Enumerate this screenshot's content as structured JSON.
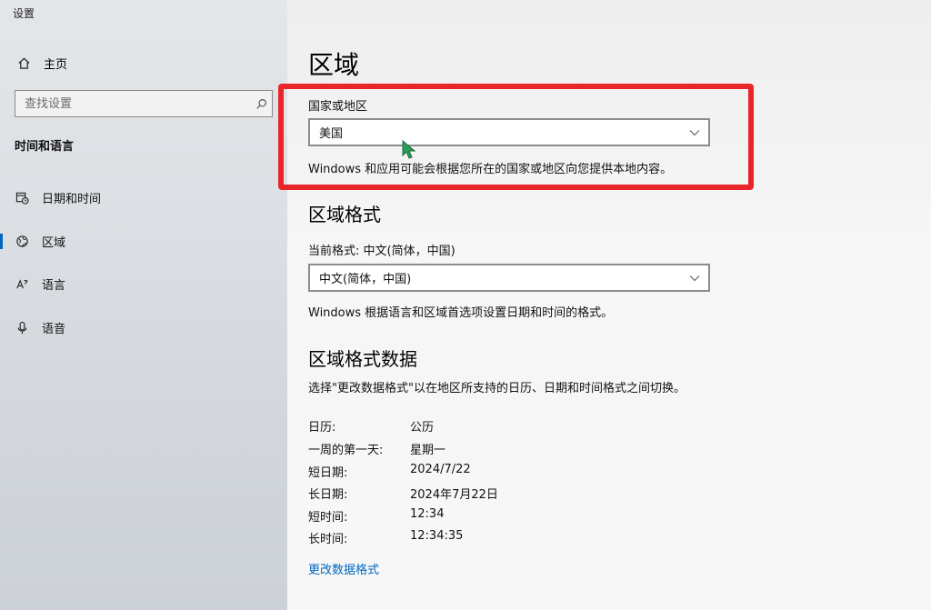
{
  "window": {
    "title": "设置"
  },
  "sidebar": {
    "home_label": "主页",
    "search_placeholder": "查找设置",
    "section_title": "时间和语言",
    "items": [
      {
        "label": "日期和时间",
        "icon": "calendar-clock-icon",
        "active": false
      },
      {
        "label": "区域",
        "icon": "globe-icon",
        "active": true
      },
      {
        "label": "语言",
        "icon": "language-icon",
        "active": false
      },
      {
        "label": "语音",
        "icon": "microphone-icon",
        "active": false
      }
    ]
  },
  "main": {
    "title": "区域",
    "country": {
      "label": "国家或地区",
      "selected": "美国",
      "description": "Windows 和应用可能会根据您所在的国家或地区向您提供本地内容。"
    },
    "format": {
      "heading": "区域格式",
      "current_label": "当前格式: 中文(简体，中国)",
      "selected": "中文(简体，中国)",
      "description": "Windows 根据语言和区域首选项设置日期和时间的格式。"
    },
    "format_data": {
      "heading": "区域格式数据",
      "description": "选择\"更改数据格式\"以在地区所支持的日历、日期和时间格式之间切换。",
      "rows": [
        {
          "key": "日历:",
          "value": "公历"
        },
        {
          "key": "一周的第一天:",
          "value": "星期一"
        },
        {
          "key": "短日期:",
          "value": "2024/7/22"
        },
        {
          "key": "长日期:",
          "value": "2024年7月22日"
        },
        {
          "key": "短时间:",
          "value": "12:34"
        },
        {
          "key": "长时间:",
          "value": "12:34:35"
        }
      ],
      "change_link": "更改数据格式"
    }
  },
  "colors": {
    "accent": "#0067c0",
    "highlight_box": "#e8252b"
  }
}
